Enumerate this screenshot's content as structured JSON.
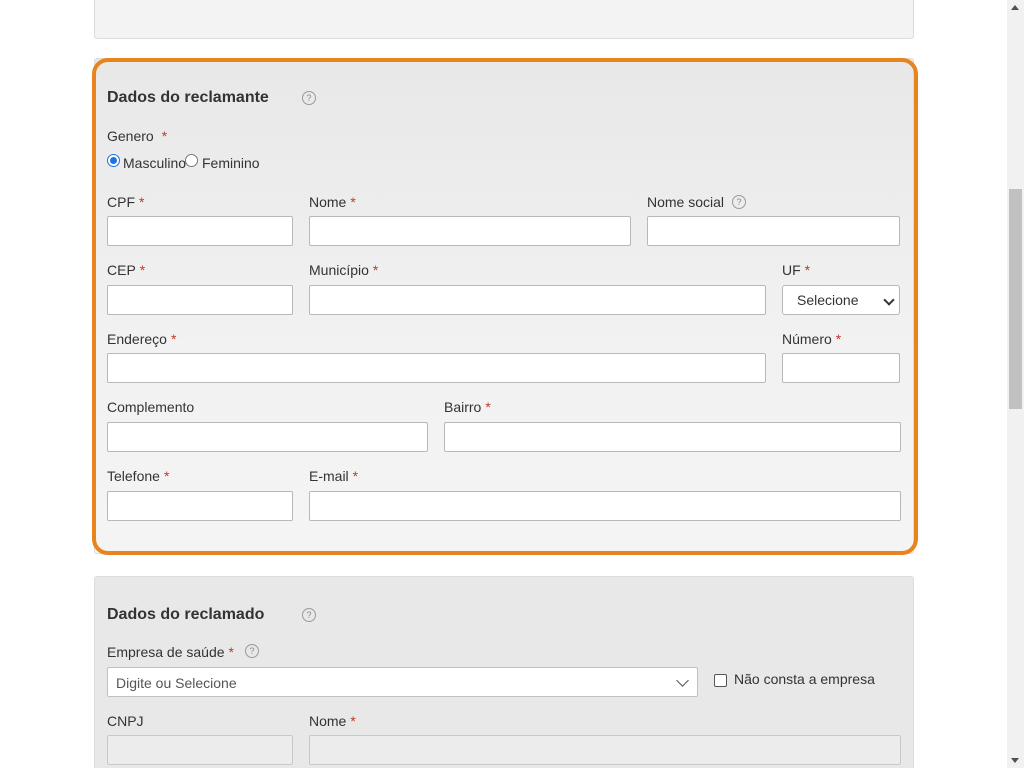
{
  "complainant": {
    "title": "Dados do reclamante",
    "help_glyph": "?",
    "gender": {
      "label": "Genero",
      "required_mark": "*",
      "options": [
        {
          "label": "Masculino",
          "selected": true
        },
        {
          "label": "Feminino",
          "selected": false
        }
      ]
    },
    "fields": {
      "cpf": {
        "label": "CPF",
        "required": "*",
        "value": ""
      },
      "nome": {
        "label": "Nome",
        "required": "*",
        "value": ""
      },
      "nome_social": {
        "label": "Nome social",
        "value": ""
      },
      "cep": {
        "label": "CEP",
        "required": "*",
        "value": ""
      },
      "municipio": {
        "label": "Município",
        "required": "*",
        "value": ""
      },
      "uf": {
        "label": "UF",
        "required": "*",
        "value": "Selecione"
      },
      "endereco": {
        "label": "Endereço",
        "required": "*",
        "value": ""
      },
      "numero": {
        "label": "Número",
        "required": "*",
        "value": ""
      },
      "complemento": {
        "label": "Complemento",
        "value": ""
      },
      "bairro": {
        "label": "Bairro",
        "required": "*",
        "value": ""
      },
      "telefone": {
        "label": "Telefone",
        "required": "*",
        "value": ""
      },
      "email": {
        "label": "E-mail",
        "required": "*",
        "value": ""
      }
    }
  },
  "respondent": {
    "title": "Dados do reclamado",
    "help_glyph": "?",
    "empresa": {
      "label": "Empresa de saúde",
      "required": "*",
      "placeholder": "Digite ou Selecione"
    },
    "nao_consta": {
      "label": "Não consta a empresa",
      "checked": false
    },
    "cnpj": {
      "label": "CNPJ",
      "value": ""
    },
    "nome": {
      "label": "Nome",
      "required": "*",
      "value": ""
    }
  },
  "colors": {
    "highlight": "#e8841e",
    "required": "#c0392b",
    "radio": "#1a73e8"
  }
}
